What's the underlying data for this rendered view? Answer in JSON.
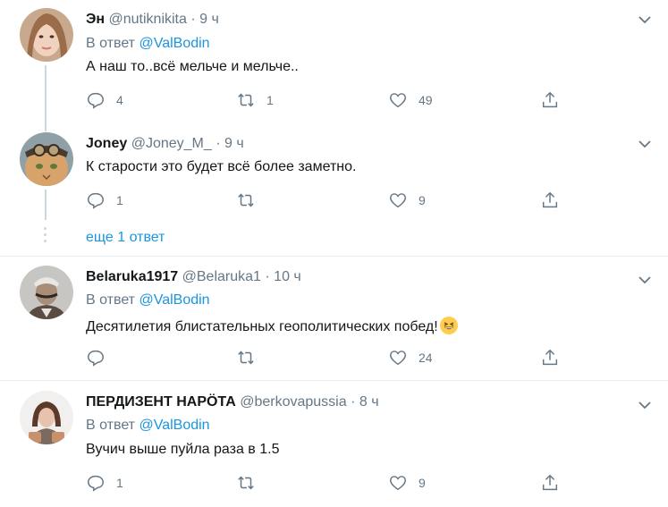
{
  "tweets": [
    {
      "name": "Эн",
      "handle": "@nutiknikita",
      "dot": "·",
      "time": "9 ч",
      "reply_prefix": "В ответ",
      "reply_mention": "@ValBodin",
      "text": "А наш то..всё мельче и мельче..",
      "replies": "4",
      "retweets": "1",
      "likes": "49"
    },
    {
      "name": "Joney",
      "handle": "@Joney_M_",
      "dot": "·",
      "time": "9 ч",
      "text": "К старости это будет всё более заметно.",
      "replies": "1",
      "retweets": "",
      "likes": "9"
    },
    {
      "name": "Belaruka1917",
      "handle": "@Belaruka1",
      "dot": "·",
      "time": "10 ч",
      "reply_prefix": "В ответ",
      "reply_mention": "@ValBodin",
      "text": "Десятилетия блистательных геополитических побед!",
      "replies": "",
      "retweets": "",
      "likes": "24"
    },
    {
      "name": "ПЕРДИЗЕНТ НАРÖТА",
      "handle": "@berkovapussia",
      "dot": "·",
      "time": "8 ч",
      "reply_prefix": "В ответ",
      "reply_mention": "@ValBodin",
      "text": "Вучич выше пуйла раза в 1.5",
      "replies": "1",
      "retweets": "",
      "likes": "9"
    }
  ],
  "more_replies": "еще 1 ответ",
  "colors": {
    "accent": "#1b95e0",
    "muted": "#657786",
    "separator": "#e6ecf0",
    "thread_line": "#ccd6dd"
  },
  "icons": [
    "chevron-down-icon",
    "reply-icon",
    "retweet-icon",
    "like-icon",
    "share-icon",
    "grinning-emoji"
  ]
}
